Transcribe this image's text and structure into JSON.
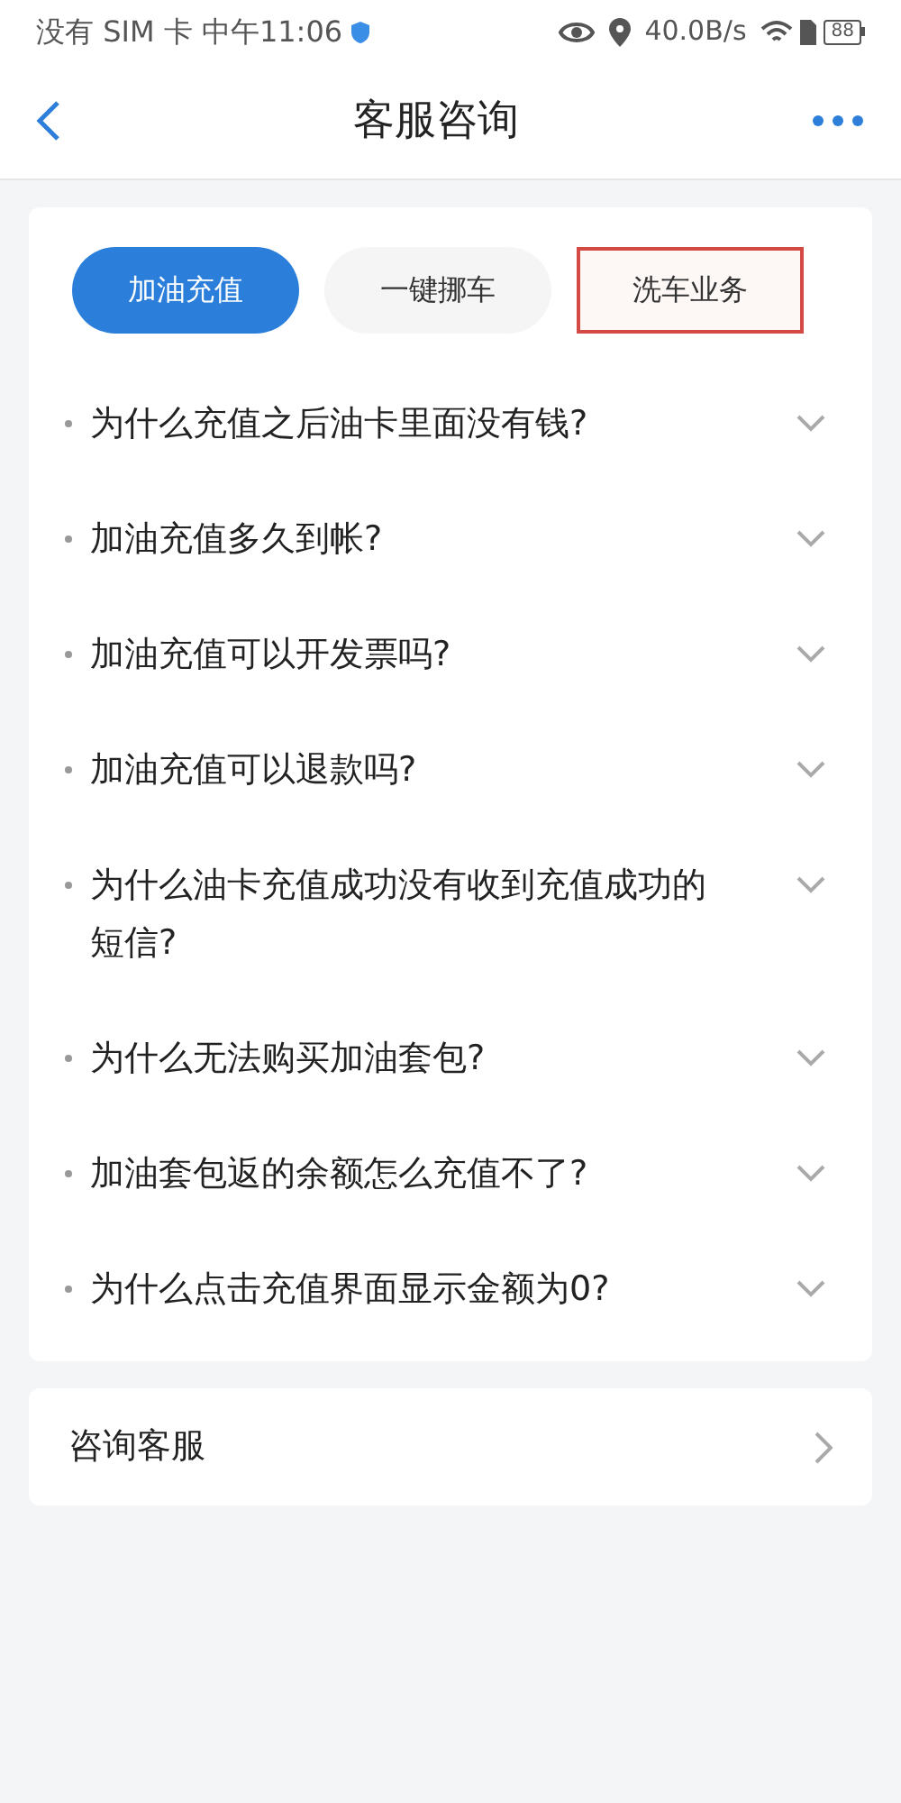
{
  "status_bar": {
    "carrier_time": "没有 SIM 卡 中午11:06",
    "speed": "40.0B/s",
    "battery": "88"
  },
  "header": {
    "title": "客服咨询"
  },
  "tabs": [
    {
      "label": "加油充值",
      "selected": true,
      "highlighted": false
    },
    {
      "label": "一键挪车",
      "selected": false,
      "highlighted": false
    },
    {
      "label": "洗车业务",
      "selected": false,
      "highlighted": true
    }
  ],
  "questions": [
    {
      "text": "为什么充值之后油卡里面没有钱?",
      "expanded": false
    },
    {
      "text": "加油充值多久到帐?",
      "expanded": false
    },
    {
      "text": "加油充值可以开发票吗?",
      "expanded": false
    },
    {
      "text": "加油充值可以退款吗?",
      "expanded": false
    },
    {
      "text": "为什么油卡充值成功没有收到充值成功的短信?",
      "expanded": false
    },
    {
      "text": "为什么无法购买加油套包?",
      "expanded": false
    },
    {
      "text": "加油套包返的余额怎么充值不了?",
      "expanded": false
    },
    {
      "text": "为什么点击充值界面显示金额为0?",
      "expanded": false
    }
  ],
  "contact": {
    "label": "咨询客服"
  }
}
